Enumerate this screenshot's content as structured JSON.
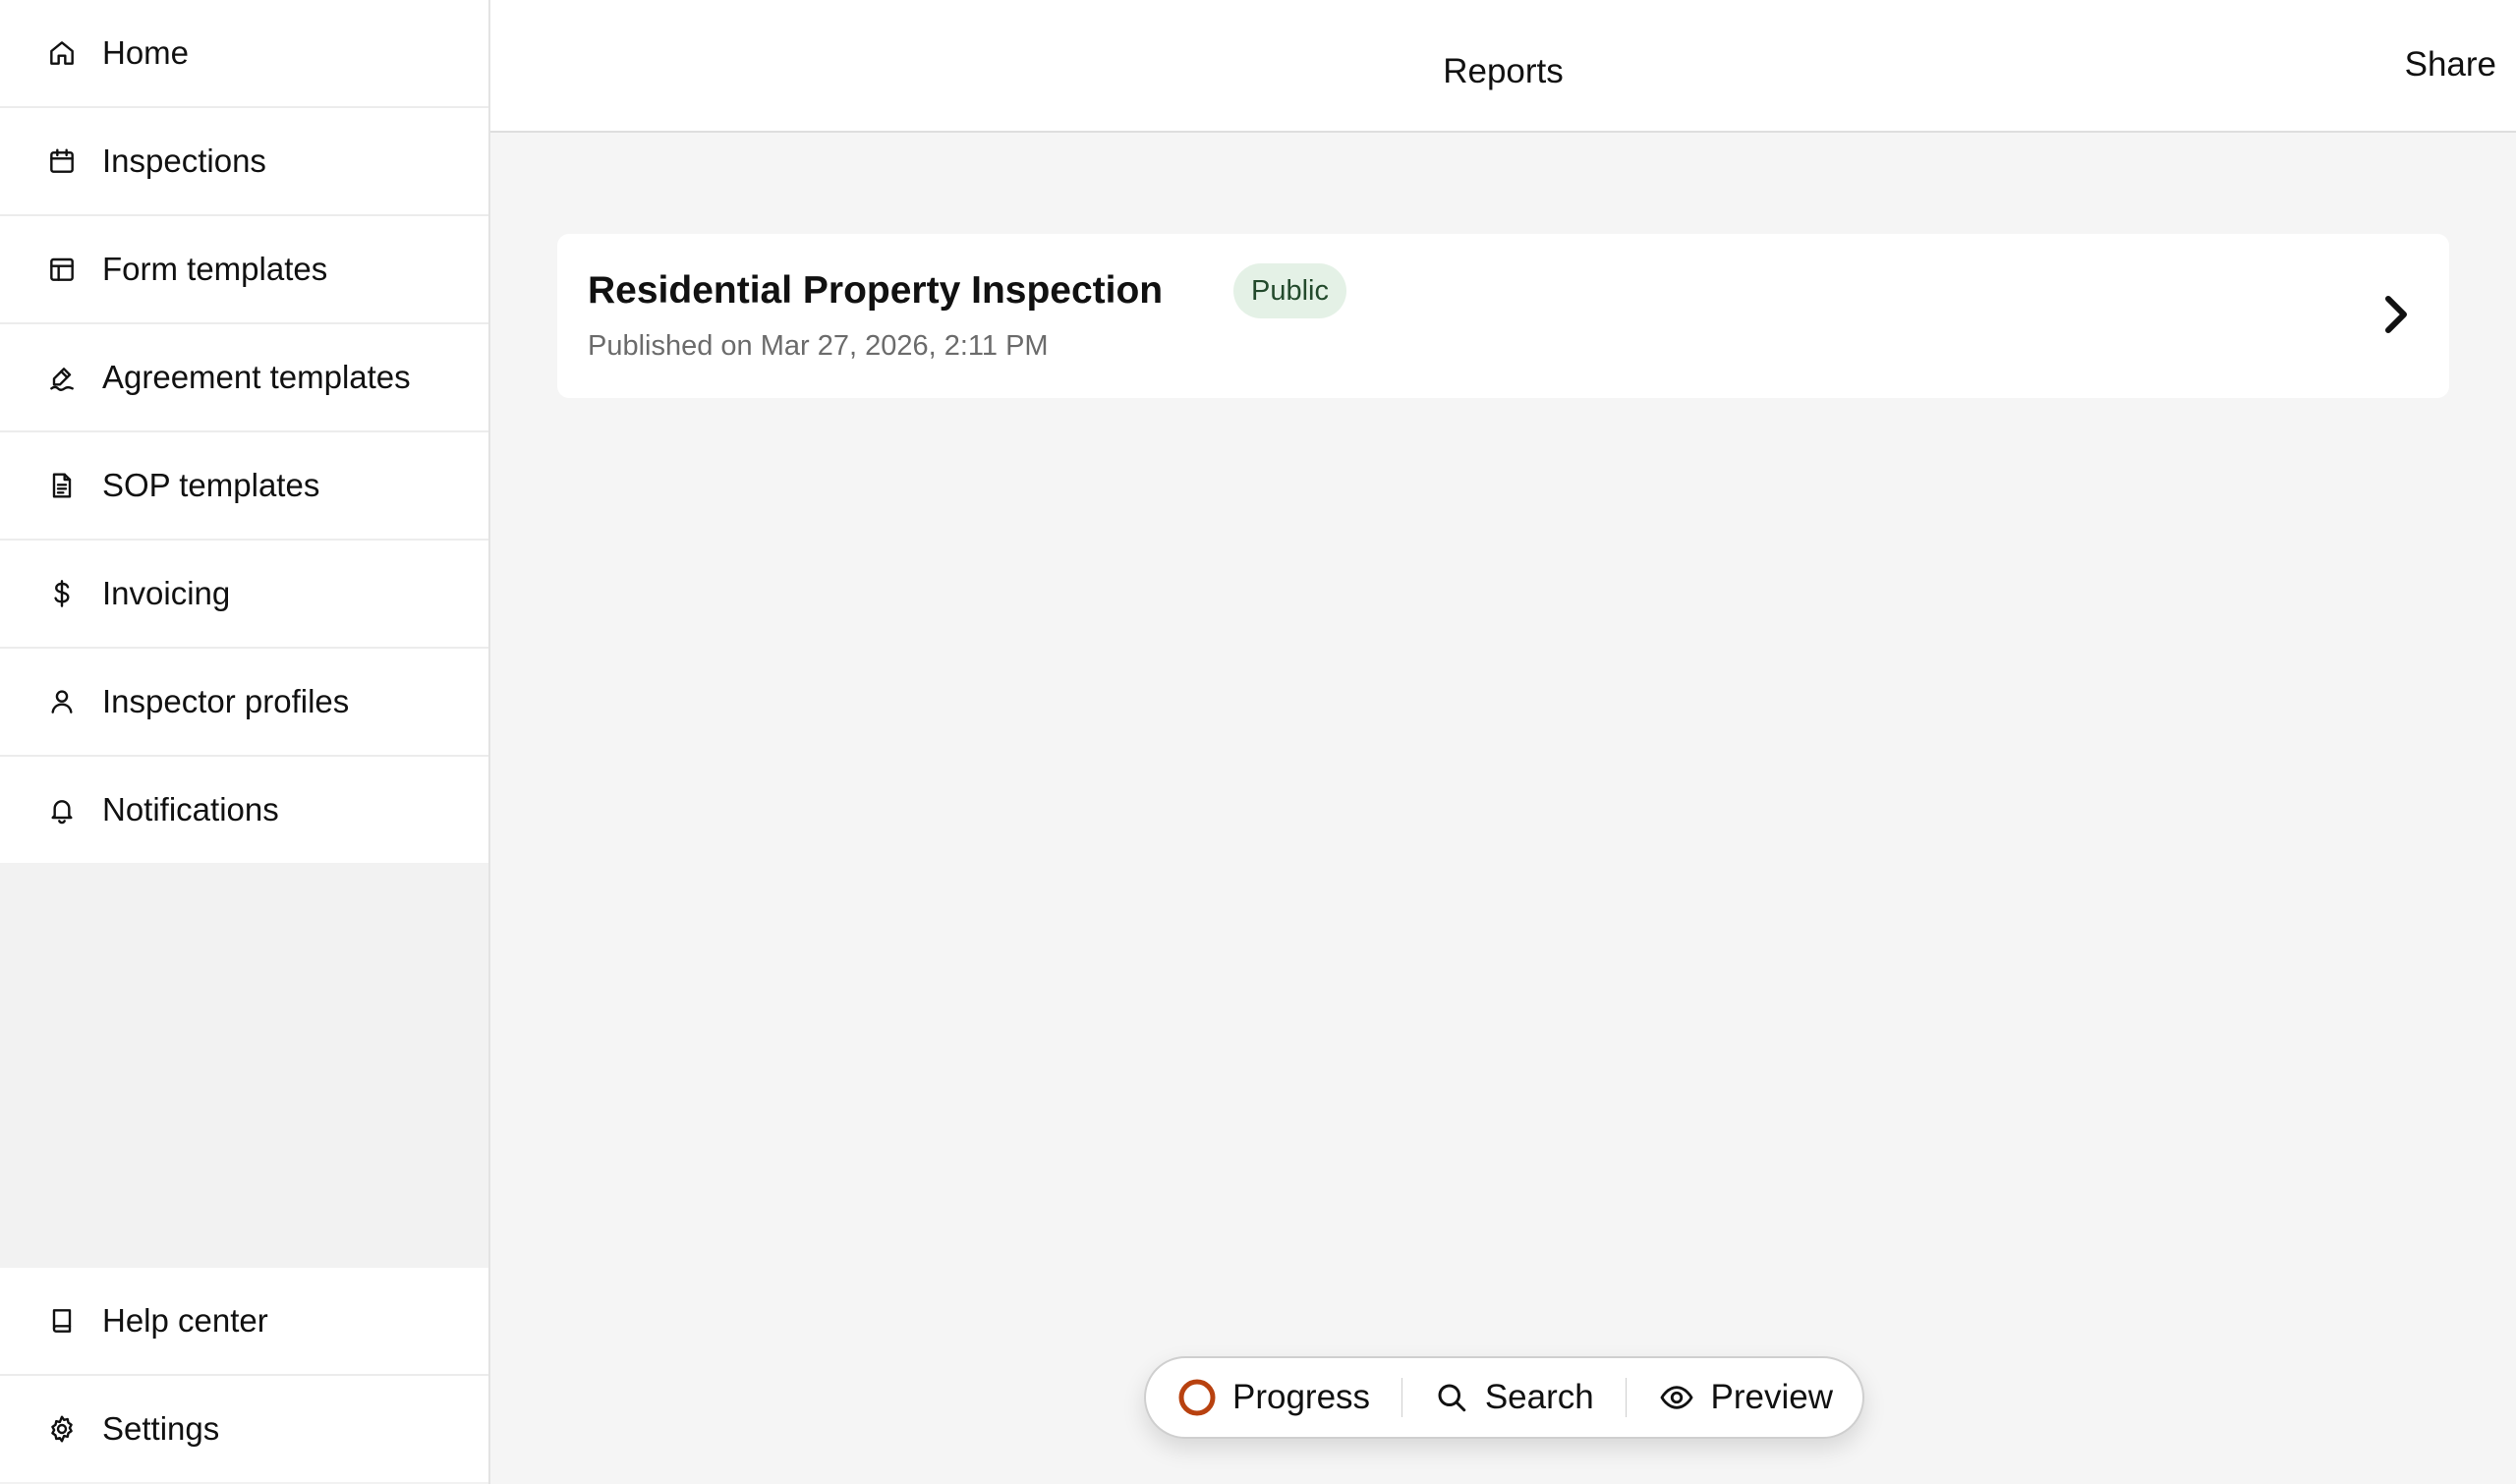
{
  "sidebar": {
    "items": [
      {
        "label": "Home",
        "icon": "home-icon"
      },
      {
        "label": "Inspections",
        "icon": "calendar-icon"
      },
      {
        "label": "Form templates",
        "icon": "layout-icon"
      },
      {
        "label": "Agreement templates",
        "icon": "signature-icon"
      },
      {
        "label": "SOP templates",
        "icon": "document-icon"
      },
      {
        "label": "Invoicing",
        "icon": "dollar-icon"
      },
      {
        "label": "Inspector profiles",
        "icon": "user-icon"
      },
      {
        "label": "Notifications",
        "icon": "bell-icon"
      }
    ],
    "footer_items": [
      {
        "label": "Help center",
        "icon": "book-icon"
      },
      {
        "label": "Settings",
        "icon": "gear-icon"
      }
    ]
  },
  "header": {
    "title": "Reports",
    "share_label": "Share"
  },
  "reports": [
    {
      "title": "Residential Property Inspection",
      "badge": "Public",
      "published": "Published on Mar 27, 2026, 2:11 PM"
    }
  ],
  "toolbar": {
    "progress_label": "Progress",
    "search_label": "Search",
    "preview_label": "Preview"
  },
  "colors": {
    "progress_ring": "#b8410f",
    "badge_bg": "#e4f1e6",
    "badge_text": "#234a2c"
  }
}
